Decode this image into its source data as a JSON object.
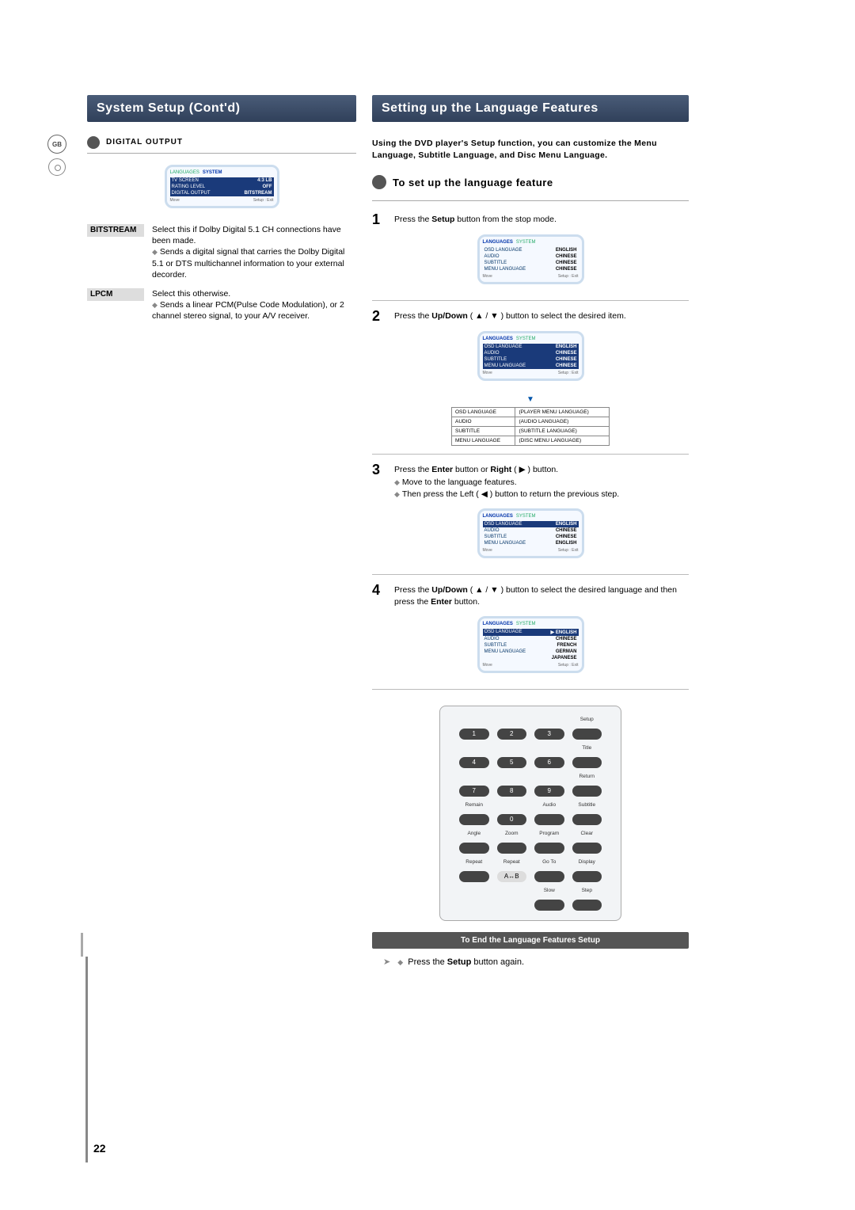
{
  "side": {
    "lang_code": "GB"
  },
  "left": {
    "title": "System Setup (Cont'd)",
    "section": "DIGITAL OUTPUT",
    "osd": {
      "tab_left": "LANGUAGES",
      "tab_right": "SYSTEM",
      "rows": [
        {
          "label": "TV SCREEN",
          "value": "4:3 LB"
        },
        {
          "label": "RATING LEVEL",
          "value": "OFF"
        },
        {
          "label": "DIGITAL OUTPUT",
          "value": "BITSTREAM"
        }
      ],
      "foot_left": "Move",
      "foot_right": "Setup : Exit"
    },
    "items": [
      {
        "term": "BITSTREAM",
        "desc": "Select this if Dolby Digital 5.1 CH connections have been made.",
        "bullets": [
          "Sends a digital signal that carries the Dolby Digital 5.1 or DTS multichannel information to your external decorder."
        ]
      },
      {
        "term": "LPCM",
        "desc": "Select this otherwise.",
        "bullets": [
          "Sends a linear PCM(Pulse Code Modulation), or 2 channel stereo signal, to your A/V receiver."
        ]
      }
    ]
  },
  "right": {
    "title": "Setting up the Language Features",
    "intro": "Using the DVD player's Setup function, you can customize the Menu Language, Subtitle Language, and Disc Menu Language.",
    "subhead": "To set up the language feature",
    "steps": [
      {
        "n": "1",
        "text_a": "Press the ",
        "bold_a": "Setup",
        "text_b": " button from the stop mode."
      },
      {
        "n": "2",
        "text_a": "Press the ",
        "bold_a": "Up/Down",
        "text_b": " ( ▲ / ▼ ) button  to select the desired item."
      },
      {
        "n": "3",
        "text_a": "Press the ",
        "bold_a": "Enter",
        "text_b": " button or ",
        "bold_b": "Right",
        "text_c": " ( ▶ ) button.",
        "bullets": [
          "Move to the language features.",
          "Then press the Left ( ◀ ) button to return the previous step."
        ]
      },
      {
        "n": "4",
        "text_a": "Press the ",
        "bold_a": "Up/Down",
        "text_b": " ( ▲ / ▼ ) button to select the desired language and then press the ",
        "bold_b": "Enter",
        "text_c": " button."
      }
    ],
    "osd_lang": {
      "tab_left": "LANGUAGES",
      "tab_right": "SYSTEM",
      "rows": [
        {
          "label": "OSD LANGUAGE",
          "value": "ENGLISH"
        },
        {
          "label": "AUDIO",
          "value": "CHINESE"
        },
        {
          "label": "SUBTITLE",
          "value": "CHINESE"
        },
        {
          "label": "MENU LANGUAGE",
          "value": "CHINESE"
        }
      ],
      "foot_left": "Move",
      "foot_right": "Setup : Exit"
    },
    "sub_table": [
      {
        "l": "OSD LANGUAGE",
        "r": "(PLAYER MENU LANGUAGE)"
      },
      {
        "l": "AUDIO",
        "r": "(AUDIO LANGUAGE)"
      },
      {
        "l": "SUBTITLE",
        "r": "(SUBTITLE LANGUAGE)"
      },
      {
        "l": "MENU LANGUAGE",
        "r": "(DISC MENU LANGUAGE)"
      }
    ],
    "osd_step3": {
      "rows": [
        {
          "label": "OSD LANGUAGE",
          "value": "ENGLISH",
          "hl": true
        },
        {
          "label": "AUDIO",
          "value": "CHINESE"
        },
        {
          "label": "SUBTITLE",
          "value": "CHINESE"
        },
        {
          "label": "MENU LANGUAGE",
          "value": "ENGLISH"
        }
      ]
    },
    "osd_step4": {
      "rows": [
        {
          "label": "OSD LANGUAGE",
          "value": "▶ ENGLISH",
          "hl": true
        },
        {
          "label": "AUDIO",
          "value": "CHINESE"
        },
        {
          "label": "SUBTITLE",
          "value": "FRENCH"
        },
        {
          "label": "MENU LANGUAGE",
          "value": "GERMAN"
        },
        {
          "label": "",
          "value": "JAPANESE"
        }
      ]
    },
    "remote": {
      "top_right": "Setup",
      "num_row1": [
        "1",
        "2",
        "3"
      ],
      "label_r1_last": "Title",
      "num_row2": [
        "4",
        "5",
        "6"
      ],
      "label_r2_last": "Return",
      "num_row3": [
        "7",
        "8",
        "9"
      ],
      "labels3": [
        "Remain",
        "0",
        "Audio",
        "Subtitle"
      ],
      "labels4": [
        "Angle",
        "Zoom",
        "Program",
        "Clear"
      ],
      "labels5": [
        "Repeat",
        "Repeat",
        "Go To",
        "Display"
      ],
      "ab": "A↔B",
      "labels6": [
        "",
        "",
        "Slow",
        "Step"
      ]
    },
    "end_bar": "To End the Language Features Setup",
    "final_a": "Press the ",
    "final_bold": "Setup",
    "final_b": " button again."
  },
  "pagenum": "22"
}
